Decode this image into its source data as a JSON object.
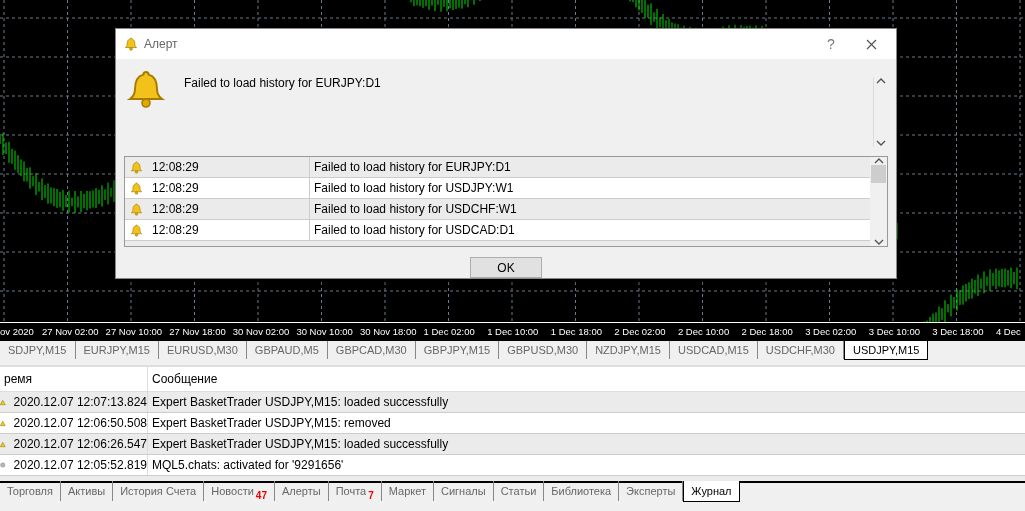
{
  "chart": {
    "time_axis": [
      "ov 2020",
      "27 Nov 02:00",
      "27 Nov 10:00",
      "27 Nov 18:00",
      "30 Nov 02:00",
      "30 Nov 10:00",
      "30 Nov 18:00",
      "1 Dec 02:00",
      "1 Dec 10:00",
      "1 Dec 18:00",
      "2 Dec 02:00",
      "2 Dec 10:00",
      "2 Dec 18:00",
      "3 Dec 02:00",
      "3 Dec 10:00",
      "3 Dec 18:00",
      "4 Dec"
    ]
  },
  "chart_tabs": [
    {
      "label": "SDJPY,M15",
      "selected": false
    },
    {
      "label": "EURJPY,M15",
      "selected": false
    },
    {
      "label": "EURUSD,M30",
      "selected": false
    },
    {
      "label": "GBPAUD,M5",
      "selected": false
    },
    {
      "label": "GBPCAD,M30",
      "selected": false
    },
    {
      "label": "GBPJPY,M15",
      "selected": false
    },
    {
      "label": "GBPUSD,M30",
      "selected": false
    },
    {
      "label": "NZDJPY,M15",
      "selected": false
    },
    {
      "label": "USDCAD,M15",
      "selected": false
    },
    {
      "label": "USDCHF,M30",
      "selected": false
    },
    {
      "label": "USDJPY,M15",
      "selected": true
    }
  ],
  "journal": {
    "columns": [
      "ремя",
      "Сообщение"
    ],
    "rows": [
      {
        "kind": "warning",
        "time": "2020.12.07 12:07:13.824",
        "message": "Expert BasketTrader USDJPY,M15: loaded successfully"
      },
      {
        "kind": "warning",
        "time": "2020.12.07 12:06:50.508",
        "message": "Expert BasketTrader USDJPY,M15: removed"
      },
      {
        "kind": "warning",
        "time": "2020.12.07 12:06:26.547",
        "message": "Expert BasketTrader USDJPY,M15: loaded successfully"
      },
      {
        "kind": "info",
        "time": "2020.12.07 12:05:52.819",
        "message": "MQL5.chats: activated for '9291656'"
      }
    ]
  },
  "bottom_tabs": [
    {
      "label": "Торговля",
      "selected": false
    },
    {
      "label": "Активы",
      "selected": false
    },
    {
      "label": "История Счета",
      "selected": false
    },
    {
      "label": "Новости",
      "badge": "47",
      "selected": false
    },
    {
      "label": "Алерты",
      "selected": false
    },
    {
      "label": "Почта",
      "badge": "7",
      "selected": false
    },
    {
      "label": "Маркет",
      "selected": false
    },
    {
      "label": "Сигналы",
      "selected": false
    },
    {
      "label": "Статьи",
      "selected": false
    },
    {
      "label": "Библиотека",
      "selected": false
    },
    {
      "label": "Эксперты",
      "selected": false
    },
    {
      "label": "Журнал",
      "selected": true
    }
  ],
  "dialog": {
    "title": "Алерт",
    "help": "?",
    "message": "Failed to load history for EURJPY:D1",
    "alerts": [
      {
        "time": "12:08:29",
        "message": "Failed to load history for EURJPY:D1"
      },
      {
        "time": "12:08:29",
        "message": "Failed to load history for USDJPY:W1"
      },
      {
        "time": "12:08:29",
        "message": "Failed to load history for USDCHF:W1"
      },
      {
        "time": "12:08:29",
        "message": "Failed to load history for USDCAD:D1"
      }
    ],
    "ok_button": "OK"
  }
}
